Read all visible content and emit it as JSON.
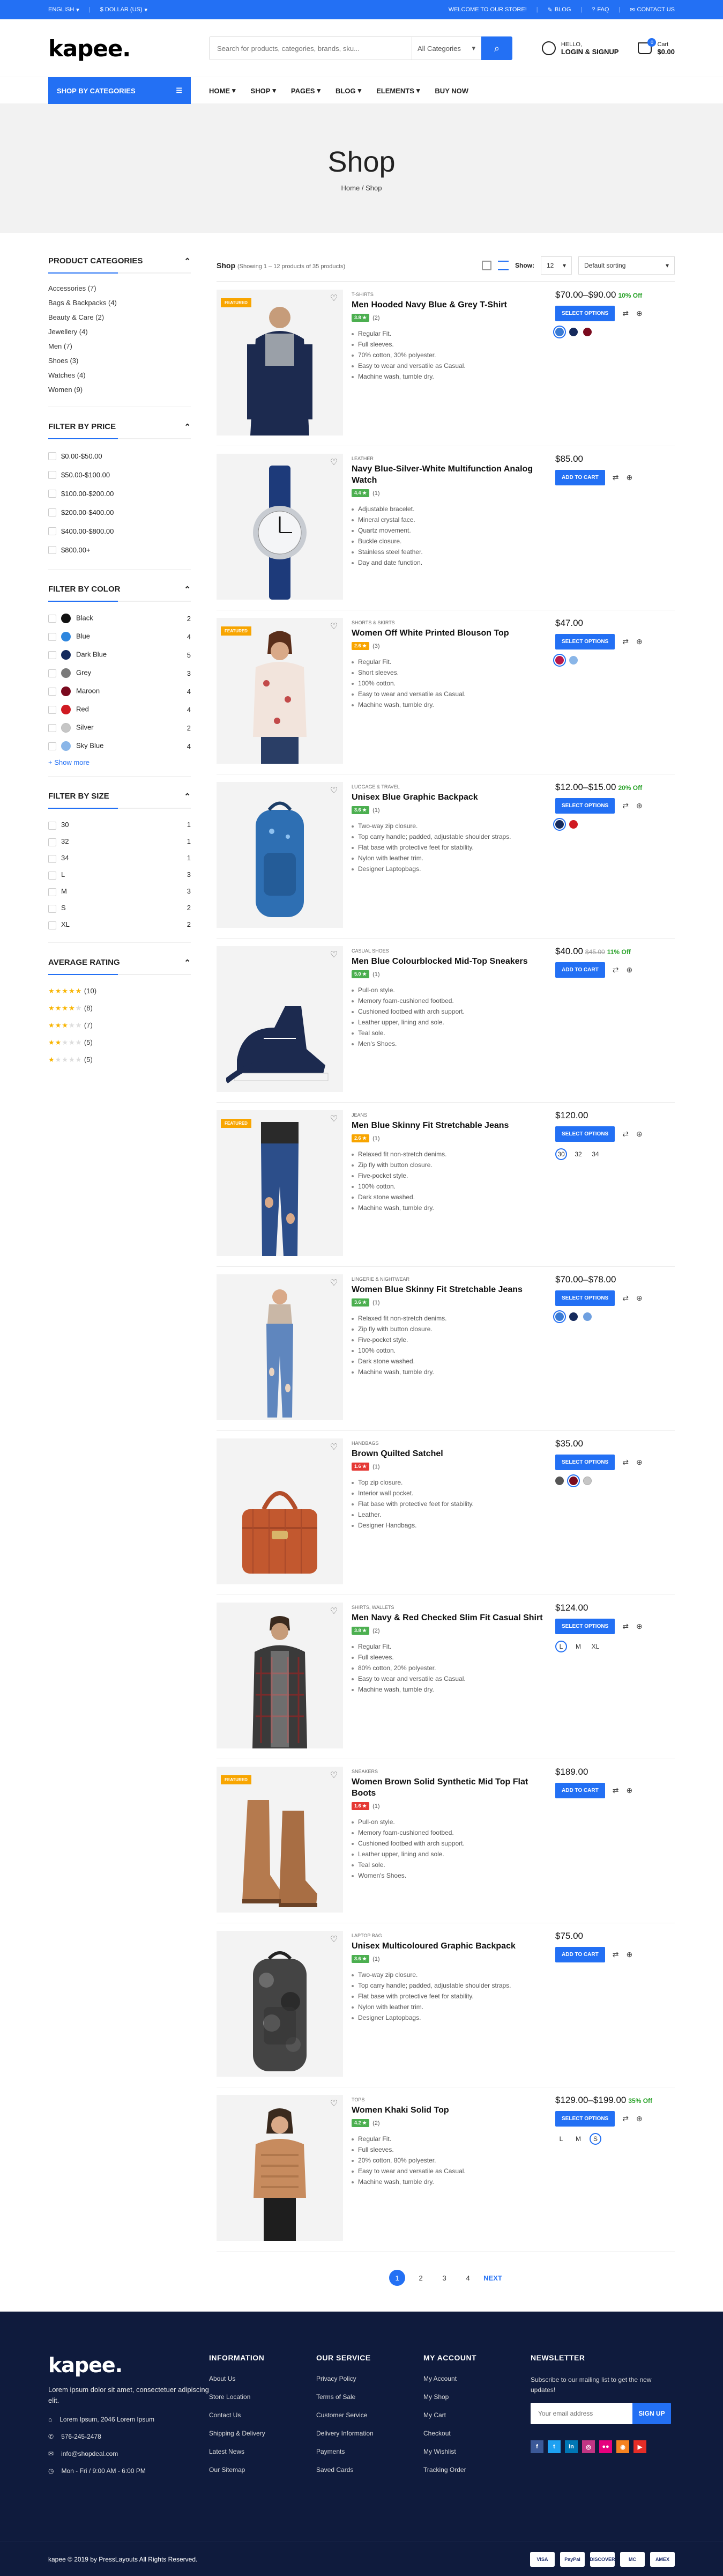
{
  "topbar": {
    "language": "ENGLISH",
    "currency": "$ DOLLAR (US)",
    "welcome": "WELCOME TO OUR STORE!",
    "blog": "BLOG",
    "faq": "FAQ",
    "contact": "CONTACT US"
  },
  "header": {
    "logo": "kapee.",
    "search_placeholder": "Search for products, categories, brands, sku...",
    "search_category": "All Categories",
    "account_top": "HELLO,",
    "account_bottom": "LOGIN & SIGNUP",
    "cart_top": "Cart",
    "cart_amount": "$0.00",
    "cart_count": "0"
  },
  "nav": {
    "shop_by": "SHOP BY CATEGORIES",
    "items": [
      "HOME",
      "SHOP",
      "PAGES",
      "BLOG",
      "ELEMENTS",
      "BUY NOW"
    ]
  },
  "banner": {
    "title": "Shop",
    "crumb_home": "Home",
    "crumb_sep": "/",
    "crumb_current": "Shop"
  },
  "sidebar": {
    "categories_title": "PRODUCT CATEGORIES",
    "categories": [
      "Accessories (7)",
      "Bags & Backpacks (4)",
      "Beauty & Care (2)",
      "Jewellery (4)",
      "Men (7)",
      "Shoes (3)",
      "Watches (4)",
      "Women (9)"
    ],
    "price_title": "FILTER BY PRICE",
    "prices": [
      "$0.00-$50.00",
      "$50.00-$100.00",
      "$100.00-$200.00",
      "$200.00-$400.00",
      "$400.00-$800.00",
      "$800.00+"
    ],
    "color_title": "FILTER BY COLOR",
    "colors": [
      {
        "name": "Black",
        "count": "2",
        "hex": "#111111"
      },
      {
        "name": "Blue",
        "count": "4",
        "hex": "#2E86DE"
      },
      {
        "name": "Dark Blue",
        "count": "5",
        "hex": "#152A5C"
      },
      {
        "name": "Grey",
        "count": "3",
        "hex": "#7A7A7A"
      },
      {
        "name": "Maroon",
        "count": "4",
        "hex": "#7A0A1E"
      },
      {
        "name": "Red",
        "count": "4",
        "hex": "#D01A22"
      },
      {
        "name": "Silver",
        "count": "2",
        "hex": "#C6C6C6"
      },
      {
        "name": "Sky Blue",
        "count": "4",
        "hex": "#8AB6E8"
      }
    ],
    "show_more": "+ Show more",
    "size_title": "FILTER BY SIZE",
    "sizes": [
      {
        "name": "30",
        "count": "1"
      },
      {
        "name": "32",
        "count": "1"
      },
      {
        "name": "34",
        "count": "1"
      },
      {
        "name": "L",
        "count": "3"
      },
      {
        "name": "M",
        "count": "3"
      },
      {
        "name": "S",
        "count": "2"
      },
      {
        "name": "XL",
        "count": "2"
      }
    ],
    "rating_title": "AVERAGE RATING",
    "ratings": [
      {
        "stars": 5,
        "count": "(10)"
      },
      {
        "stars": 4,
        "count": "(8)"
      },
      {
        "stars": 3,
        "count": "(7)"
      },
      {
        "stars": 2,
        "count": "(5)"
      },
      {
        "stars": 1,
        "count": "(5)"
      }
    ]
  },
  "toolbar": {
    "title": "Shop",
    "showing": "(Showing 1 – 12 products of 35 products)",
    "show_label": "Show:",
    "show_value": "12",
    "sort": "Default sorting"
  },
  "products": [
    {
      "cat": "T-SHIRTS",
      "name": "Men Hooded Navy Blue & Grey T-Shirt",
      "rating": "3.8",
      "rating_color": "#4CAF50",
      "reviews": "(2)",
      "featured": true,
      "features": [
        "Regular Fit.",
        "Full sleeves.",
        "70% cotton, 30% polyester.",
        "Easy to wear and versatile as Casual.",
        "Machine wash, tumble dry."
      ],
      "price": "$70.00–$90.00",
      "old": "",
      "off": "10% Off",
      "btn": "SELECT OPTIONS",
      "swatches": {
        "type": "color",
        "items": [
          "#3A7BD5",
          "#152A5C",
          "#7A0A1E"
        ],
        "active": 0
      }
    },
    {
      "cat": "LEATHER",
      "name": "Navy Blue-Silver-White Multifunction Analog Watch",
      "rating": "4.4",
      "rating_color": "#4CAF50",
      "reviews": "(1)",
      "featured": false,
      "features": [
        "Adjustable bracelet.",
        "Mineral crystal face.",
        "Quartz movement.",
        "Buckle closure.",
        "Stainless steel feather.",
        "Day and date function."
      ],
      "price": "$85.00",
      "old": "",
      "off": "",
      "btn": "ADD TO CART",
      "swatches": {
        "type": "none",
        "items": [],
        "active": -1
      }
    },
    {
      "cat": "SHORTS & SKIRTS",
      "name": "Women Off White Printed Blouson Top",
      "rating": "2.6",
      "rating_color": "#F8A500",
      "reviews": "(3)",
      "featured": true,
      "features": [
        "Regular Fit.",
        "Short sleeves.",
        "100% cotton.",
        "Easy to wear and versatile as Casual.",
        "Machine wash, tumble dry."
      ],
      "price": "$47.00",
      "old": "",
      "off": "",
      "btn": "SELECT OPTIONS",
      "swatches": {
        "type": "color",
        "items": [
          "#B8174A",
          "#8AB6E8"
        ],
        "active": 0
      }
    },
    {
      "cat": "LUGGAGE & TRAVEL",
      "name": "Unisex Blue Graphic Backpack",
      "rating": "3.6",
      "rating_color": "#4CAF50",
      "reviews": "(1)",
      "featured": false,
      "features": [
        "Two-way zip closure.",
        "Top carry handle; padded, adjustable shoulder straps.",
        "Flat base with protective feet for stability.",
        "Nylon with leather trim.",
        "Designer Laptopbags."
      ],
      "price": "$12.00–$15.00",
      "old": "",
      "off": "20% Off",
      "btn": "SELECT OPTIONS",
      "swatches": {
        "type": "color",
        "items": [
          "#152A5C",
          "#D01A22"
        ],
        "active": 0
      }
    },
    {
      "cat": "CASUAL SHOES",
      "name": "Men Blue Colourblocked Mid-Top Sneakers",
      "rating": "5.0",
      "rating_color": "#4CAF50",
      "reviews": "(1)",
      "featured": false,
      "features": [
        "Pull-on style.",
        "Memory foam-cushioned footbed.",
        "Cushioned footbed with arch support.",
        "Leather upper, lining and sole.",
        "Teal sole.",
        "Men's Shoes."
      ],
      "price": "$40.00",
      "old": "$45.00",
      "off": "11% Off",
      "btn": "ADD TO CART",
      "swatches": {
        "type": "none",
        "items": [],
        "active": -1
      }
    },
    {
      "cat": "JEANS",
      "name": "Men Blue Skinny Fit Stretchable Jeans",
      "rating": "2.6",
      "rating_color": "#F8A500",
      "reviews": "(1)",
      "featured": true,
      "features": [
        "Relaxed fit non-stretch denims.",
        "Zip fly with button closure.",
        "Five-pocket style.",
        "100% cotton.",
        "Dark stone washed.",
        "Machine wash, tumble dry."
      ],
      "price": "$120.00",
      "old": "",
      "off": "",
      "btn": "SELECT OPTIONS",
      "swatches": {
        "type": "size",
        "items": [
          "30",
          "32",
          "34"
        ],
        "active": 0
      }
    },
    {
      "cat": "LINGERIE & NIGHTWEAR",
      "name": "Women Blue Skinny Fit Stretchable Jeans",
      "rating": "3.6",
      "rating_color": "#4CAF50",
      "reviews": "(1)",
      "featured": false,
      "features": [
        "Relaxed fit non-stretch denims.",
        "Zip fly with button closure.",
        "Five-pocket style.",
        "100% cotton.",
        "Dark stone washed.",
        "Machine wash, tumble dry."
      ],
      "price": "$70.00–$78.00",
      "old": "",
      "off": "",
      "btn": "SELECT OPTIONS",
      "swatches": {
        "type": "color",
        "items": [
          "#3A7BD5",
          "#152A5C",
          "#6FA0E0"
        ],
        "active": 0
      }
    },
    {
      "cat": "HANDBAGS",
      "name": "Brown Quilted Satchel",
      "rating": "1.6",
      "rating_color": "#E53935",
      "reviews": "(1)",
      "featured": false,
      "features": [
        "Top zip closure.",
        "Interior wall pocket.",
        "Flat base with protective feet for stability.",
        "Leather.",
        "Designer Handbags."
      ],
      "price": "$35.00",
      "old": "",
      "off": "",
      "btn": "SELECT OPTIONS",
      "swatches": {
        "type": "color",
        "items": [
          "#555555",
          "#7A0A1E",
          "#C6C6C6"
        ],
        "active": 1
      }
    },
    {
      "cat": "SHIRTS, WALLETS",
      "name": "Men Navy & Red Checked Slim Fit Casual Shirt",
      "rating": "3.8",
      "rating_color": "#4CAF50",
      "reviews": "(2)",
      "featured": false,
      "features": [
        "Regular Fit.",
        "Full sleeves.",
        "80% cotton, 20% polyester.",
        "Easy to wear and versatile as Casual.",
        "Machine wash, tumble dry."
      ],
      "price": "$124.00",
      "old": "",
      "off": "",
      "btn": "SELECT OPTIONS",
      "swatches": {
        "type": "size",
        "items": [
          "L",
          "M",
          "XL"
        ],
        "active": 0
      }
    },
    {
      "cat": "SNEAKERS",
      "name": "Women Brown Solid Synthetic Mid Top Flat Boots",
      "rating": "1.6",
      "rating_color": "#E53935",
      "reviews": "(1)",
      "featured": true,
      "features": [
        "Pull-on style.",
        "Memory foam-cushioned footbed.",
        "Cushioned footbed with arch support.",
        "Leather upper, lining and sole.",
        "Teal sole.",
        "Women's Shoes."
      ],
      "price": "$189.00",
      "old": "",
      "off": "",
      "btn": "ADD TO CART",
      "swatches": {
        "type": "none",
        "items": [],
        "active": -1
      }
    },
    {
      "cat": "LAPTOP BAG",
      "name": "Unisex Multicoloured Graphic Backpack",
      "rating": "3.6",
      "rating_color": "#4CAF50",
      "reviews": "(1)",
      "featured": false,
      "features": [
        "Two-way zip closure.",
        "Top carry handle; padded, adjustable shoulder straps.",
        "Flat base with protective feet for stability.",
        "Nylon with leather trim.",
        "Designer Laptopbags."
      ],
      "price": "$75.00",
      "old": "",
      "off": "",
      "btn": "ADD TO CART",
      "swatches": {
        "type": "none",
        "items": [],
        "active": -1
      }
    },
    {
      "cat": "TOPS",
      "name": "Women Khaki Solid Top",
      "rating": "4.2",
      "rating_color": "#4CAF50",
      "reviews": "(2)",
      "featured": false,
      "features": [
        "Regular Fit.",
        "Full sleeves.",
        "20% cotton, 80% polyester.",
        "Easy to wear and versatile as Casual.",
        "Machine wash, tumble dry."
      ],
      "price": "$129.00–$199.00",
      "old": "",
      "off": "35% Off",
      "btn": "SELECT OPTIONS",
      "swatches": {
        "type": "size",
        "items": [
          "L",
          "M",
          "S"
        ],
        "active": 2
      }
    }
  ],
  "pager": {
    "pages": [
      "1",
      "2",
      "3",
      "4"
    ],
    "next": "NEXT"
  },
  "footer": {
    "logo": "kapee.",
    "desc": "Lorem ipsum dolor sit amet, consectetuer adipiscing elit.",
    "address": "Lorem Ipsum, 2046 Lorem Ipsum",
    "phone": "576-245-2478",
    "email": "info@shopdeal.com",
    "hours": "Mon - Fri / 9:00 AM - 6:00 PM",
    "col1_title": "INFORMATION",
    "col1": [
      "About Us",
      "Store Location",
      "Contact Us",
      "Shipping & Delivery",
      "Latest News",
      "Our Sitemap"
    ],
    "col2_title": "OUR SERVICE",
    "col2": [
      "Privacy Policy",
      "Terms of Sale",
      "Customer Service",
      "Delivery Information",
      "Payments",
      "Saved Cards"
    ],
    "col3_title": "MY ACCOUNT",
    "col3": [
      "My Account",
      "My Shop",
      "My Cart",
      "Checkout",
      "My Wishlist",
      "Tracking Order"
    ],
    "news_title": "NEWSLETTER",
    "news_text": "Subscribe to our mailing list to get the new updates!",
    "news_placeholder": "Your email address",
    "news_btn": "SIGN UP",
    "social": [
      {
        "name": "facebook",
        "glyph": "f",
        "color": "#3B5998"
      },
      {
        "name": "twitter",
        "glyph": "t",
        "color": "#1DA1F2"
      },
      {
        "name": "linkedin",
        "glyph": "in",
        "color": "#0077B5"
      },
      {
        "name": "instagram",
        "glyph": "◎",
        "color": "#C13584"
      },
      {
        "name": "flickr",
        "glyph": "●●",
        "color": "#E6007E"
      },
      {
        "name": "rss",
        "glyph": "◉",
        "color": "#F58220"
      },
      {
        "name": "youtube",
        "glyph": "▶",
        "color": "#E52D27"
      }
    ],
    "copyright": "kapee © 2019 by PressLayouts All Rights Reserved.",
    "payments": [
      "VISA",
      "PayPal",
      "DISCOVER",
      "MC",
      "AMEX"
    ]
  }
}
